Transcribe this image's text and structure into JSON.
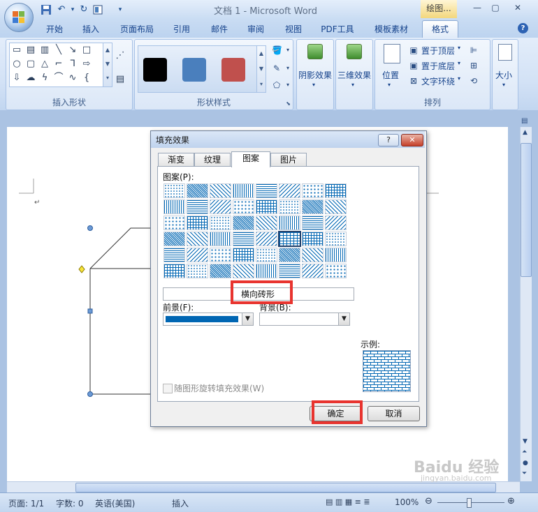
{
  "window": {
    "title": "文档 1 - Microsoft Word",
    "context_tab_label": "绘图...",
    "qat_icons": [
      "save-icon",
      "undo-icon",
      "redo-icon",
      "quick-access-more-icon"
    ]
  },
  "tabs": [
    {
      "label": "开始"
    },
    {
      "label": "插入"
    },
    {
      "label": "页面布局"
    },
    {
      "label": "引用"
    },
    {
      "label": "邮件"
    },
    {
      "label": "审阅"
    },
    {
      "label": "视图"
    },
    {
      "label": "PDF工具"
    },
    {
      "label": "模板素材"
    },
    {
      "label": "格式",
      "active": true
    }
  ],
  "ribbon": {
    "insert_shapes_label": "插入形状",
    "shape_styles_label": "形状样式",
    "arrange_label": "排列",
    "style_swatches": [
      "#000000",
      "#4a7fbd",
      "#c0504d"
    ],
    "shadow_effects_label": "阴影效果",
    "threed_effects_label": "三维效果",
    "position_label": "位置",
    "bring_front_label": "置于顶层",
    "send_back_label": "置于底层",
    "text_wrap_label": "文字环绕",
    "size_label": "大小"
  },
  "dialog": {
    "title": "填充效果",
    "help_button": "?",
    "close_button": "✕",
    "tabs": [
      "渐变",
      "纹理",
      "图案",
      "图片"
    ],
    "active_tab": "图案",
    "pattern_label": "图案(P):",
    "pattern_name": "横向砖形",
    "foreground_label": "前景(F):",
    "foreground_color": "#0066b3",
    "background_label": "背景(B):",
    "sample_label": "示例:",
    "rotate_checkbox_label": "随图形旋转填充效果(W)",
    "ok_label": "确定",
    "cancel_label": "取消"
  },
  "status_bar": {
    "page": "页面: 1/1",
    "words": "字数: 0",
    "language": "英语(美国)",
    "mode": "插入",
    "zoom": "100%"
  },
  "watermark": {
    "text": "Baidu 经验",
    "sub": "jingyan.baidu.com"
  }
}
